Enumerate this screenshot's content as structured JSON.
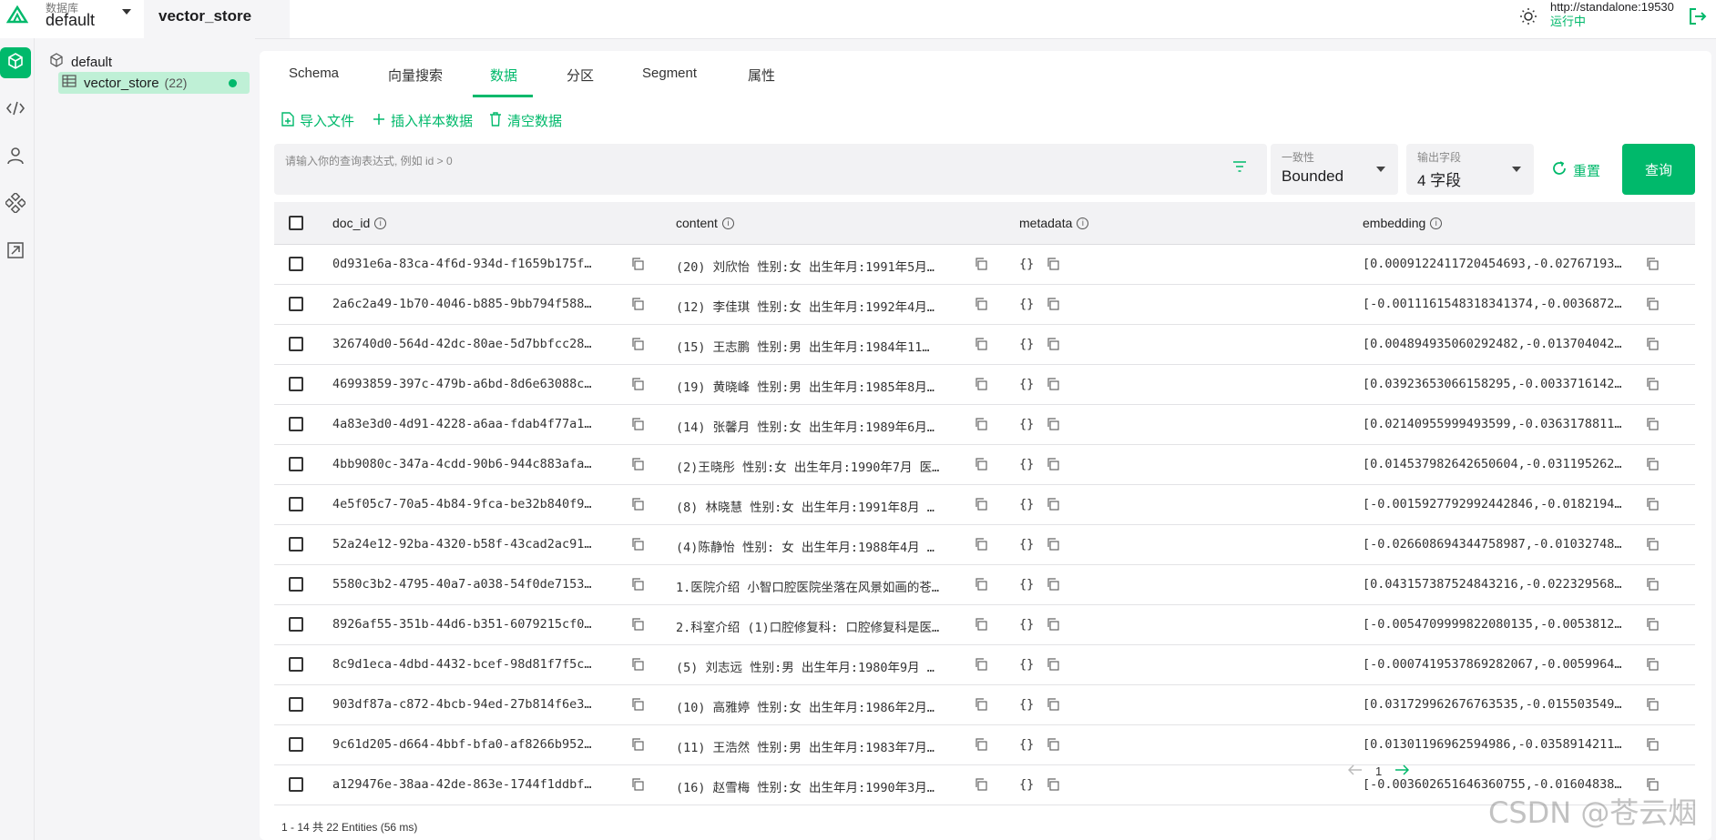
{
  "header": {
    "db_label": "数据库",
    "db_value": "default",
    "collection_tab": "vector_store",
    "server_url": "http://standalone:19530",
    "server_status": "运行中"
  },
  "tree": {
    "database": "default",
    "collection_name": "vector_store",
    "collection_count": "(22)"
  },
  "tabs": [
    "Schema",
    "向量搜索",
    "数据",
    "分区",
    "Segment",
    "属性"
  ],
  "toolbar": {
    "import": "导入文件",
    "insert_sample": "插入样本数据",
    "clear": "清空数据"
  },
  "query": {
    "placeholder": "请输入你的查询表达式, 例如 id > 0",
    "consistency_label": "一致性",
    "consistency_value": "Bounded",
    "output_label": "输出字段",
    "output_value": "4 字段",
    "reset": "重置",
    "submit": "查询"
  },
  "table": {
    "columns": [
      "doc_id",
      "content",
      "metadata",
      "embedding"
    ],
    "rows": [
      [
        "0d931e6a-83ca-4f6d-934d-f1659b175f…",
        "(20) 刘欣怡 性别:女 出生年月:1991年5月…",
        "{}",
        "[0.0009122411720454693,-0.02767193…"
      ],
      [
        "2a6c2a49-1b70-4046-b885-9bb794f588…",
        "(12) 李佳琪 性别:女 出生年月:1992年4月…",
        "{}",
        "[-0.0011161548318341374,-0.0036872…"
      ],
      [
        "326740d0-564d-42dc-80ae-5d7bbfcc28…",
        "(15) 王志鹏 性别:男 出生年月:1984年11…",
        "{}",
        "[0.004894935060292482,-0.013704042…"
      ],
      [
        "46993859-397c-479b-a6bd-8d6e63088c…",
        "(19) 黄晓峰 性别:男 出生年月:1985年8月…",
        "{}",
        "[0.03923653066158295,-0.0033716142…"
      ],
      [
        "4a83e3d0-4d91-4228-a6aa-fdab4f77a1…",
        "(14) 张馨月 性别:女 出生年月:1989年6月…",
        "{}",
        "[0.02140955999493599,-0.0363178811…"
      ],
      [
        "4bb9080c-347a-4cdd-90b6-944c883afa…",
        "(2)王晓彤 性别:女 出生年月:1990年7月 医…",
        "{}",
        "[0.014537982642650604,-0.031195262…"
      ],
      [
        "4e5f05c7-70a5-4b84-9fca-be32b840f9…",
        "(8) 林晓慧 性别:女 出生年月:1991年8月 …",
        "{}",
        "[-0.0015927792992442846,-0.0182194…"
      ],
      [
        "52a24e12-92ba-4320-b58f-43cad2ac91…",
        "(4)陈静怡 性别: 女 出生年月:1988年4月 …",
        "{}",
        "[-0.026608694344758987,-0.01032748…"
      ],
      [
        "5580c3b2-4795-40a7-a038-54f0de7153…",
        "1.医院介绍 小智口腔医院坐落在风景如画的苍…",
        "{}",
        "[0.043157387524843216,-0.022329568…"
      ],
      [
        "8926af55-351b-44d6-b351-6079215cf0…",
        "2.科室介绍 (1)口腔修复科: 口腔修复科是医…",
        "{}",
        "[-0.0054709999822080135,-0.0053812…"
      ],
      [
        "8c9d1eca-4dbd-4432-bcef-98d81f7f5c…",
        "(5) 刘志远 性别:男 出生年月:1980年9月 …",
        "{}",
        "[-0.0007419537869282067,-0.0059964…"
      ],
      [
        "903df87a-c872-4bcb-94ed-27b814f6e3…",
        "(10) 高雅婷 性别:女 出生年月:1986年2月…",
        "{}",
        "[0.031729962676763535,-0.015503549…"
      ],
      [
        "9c61d205-d664-4bbf-bfa0-af8266b952…",
        "(11) 王浩然 性别:男 出生年月:1983年7月…",
        "{}",
        "[0.01301196962594986,-0.0358914211…"
      ],
      [
        "a129476e-38aa-42de-863e-1744f1ddbf…",
        "(16) 赵雪梅 性别:女 出生年月:1990年3月…",
        "{}",
        "[-0.003602651646360755,-0.01604838…"
      ]
    ]
  },
  "footer": {
    "summary": "1 - 14  共 22 Entities (56 ms)",
    "page": "1"
  },
  "watermark": "CSDN @苍云烟",
  "colors": {
    "accent": "#00b96b",
    "selected_bg": "#bff0d6"
  }
}
